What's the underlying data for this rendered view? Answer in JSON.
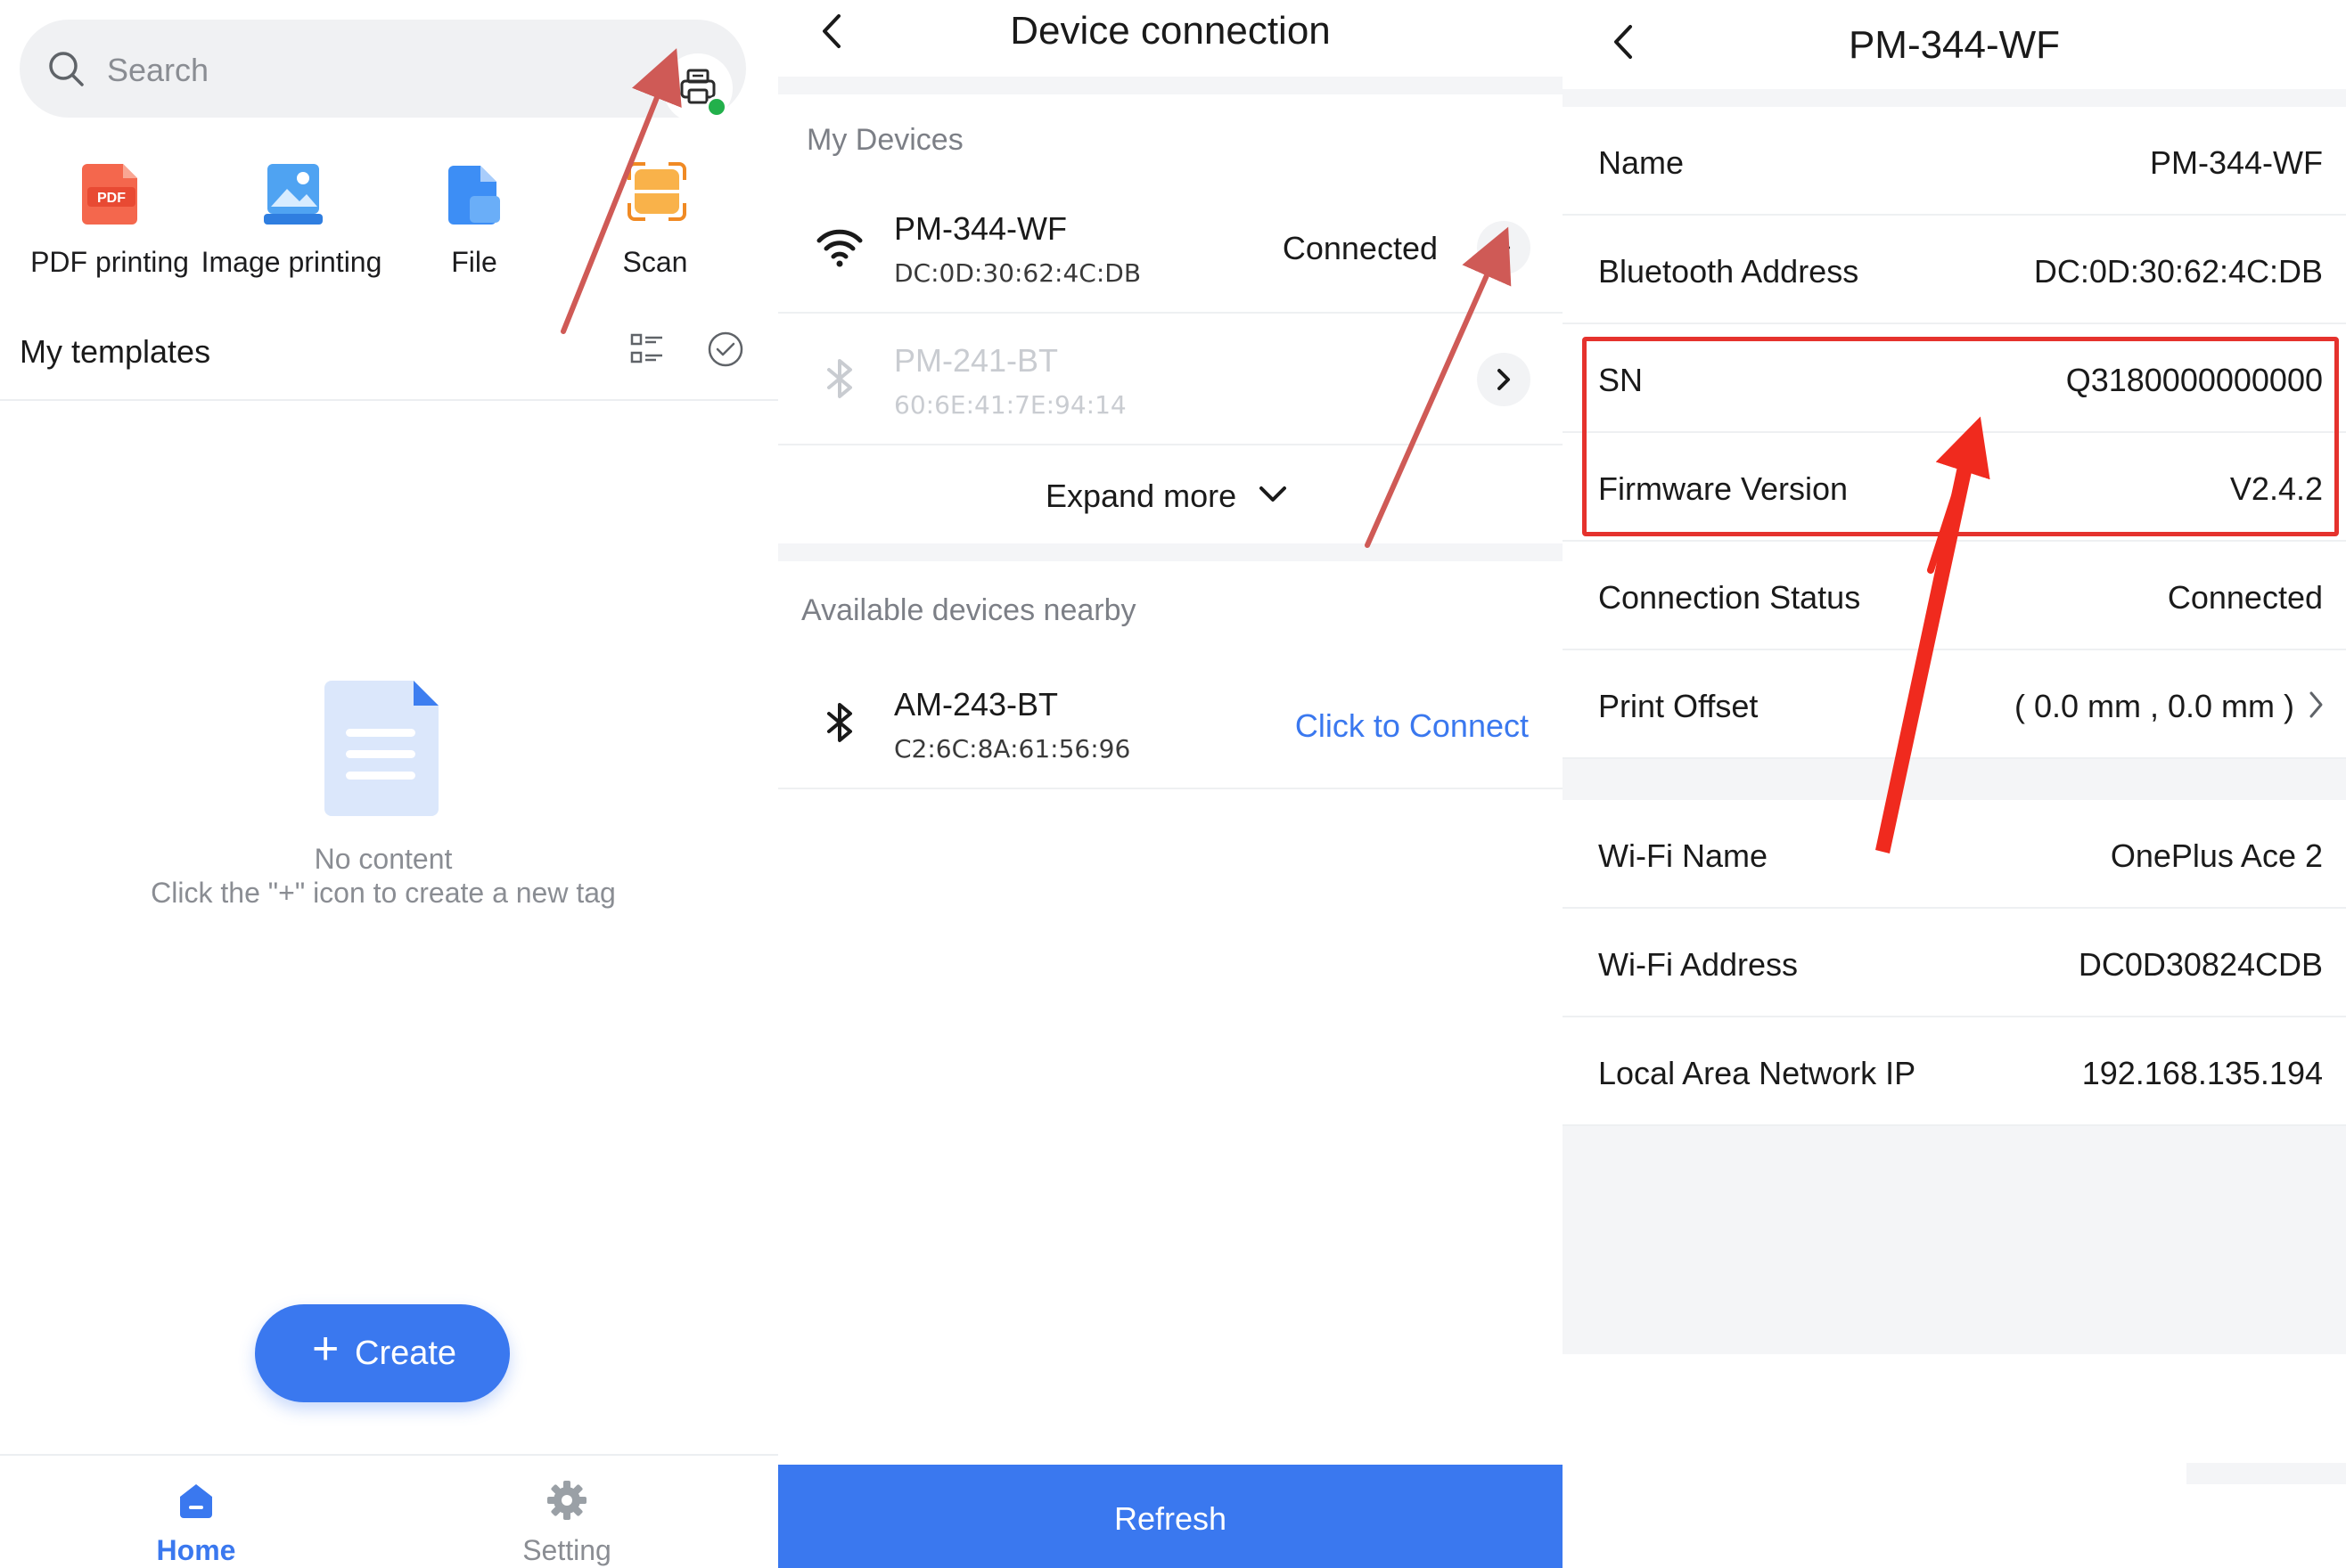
{
  "home": {
    "search_placeholder": "Search",
    "tools": [
      {
        "label": "PDF printing",
        "icon": "pdf-icon"
      },
      {
        "label": "Image printing",
        "icon": "image-icon"
      },
      {
        "label": "File",
        "icon": "file-icon"
      },
      {
        "label": "Scan",
        "icon": "scan-icon"
      }
    ],
    "pdf_badge": "PDF",
    "templates_title": "My templates",
    "empty_title": "No content",
    "empty_hint": "Click the \"+\" icon to create a new tag",
    "create_label": "Create",
    "tabs": [
      {
        "label": "Home",
        "icon": "home-icon",
        "active": true
      },
      {
        "label": "Setting",
        "icon": "gear-icon",
        "active": false
      }
    ],
    "accent_color": "#3a78ef"
  },
  "devices": {
    "title": "Device connection",
    "my_devices_label": "My Devices",
    "my_devices": [
      {
        "name": "PM-344-WF",
        "address": "DC:0D:30:62:4C:DB",
        "status": "Connected",
        "icon": "wifi-icon",
        "enabled": true
      },
      {
        "name": "PM-241-BT",
        "address": "60:6E:41:7E:94:14",
        "status": "",
        "icon": "bluetooth-icon",
        "enabled": false
      }
    ],
    "expand_label": "Expand more",
    "nearby_label": "Available devices nearby",
    "nearby": [
      {
        "name": "AM-243-BT",
        "address": "C2:6C:8A:61:56:96",
        "action": "Click to Connect",
        "icon": "bluetooth-icon"
      }
    ],
    "refresh_label": "Refresh"
  },
  "detail": {
    "title": "PM-344-WF",
    "group1": [
      {
        "label": "Name",
        "value": "PM-344-WF"
      },
      {
        "label": "Bluetooth Address",
        "value": "DC:0D:30:62:4C:DB"
      },
      {
        "label": "SN",
        "value": "Q3180000000000"
      },
      {
        "label": "Firmware Version",
        "value": "V2.4.2"
      },
      {
        "label": "Connection Status",
        "value": "Connected"
      },
      {
        "label": "Print Offset",
        "value": "( 0.0 mm , 0.0 mm )"
      }
    ],
    "group2": [
      {
        "label": "Wi-Fi Name",
        "value": "OnePlus Ace 2"
      },
      {
        "label": "Wi-Fi Address",
        "value": "DC0D30824CDB"
      },
      {
        "label": "Local Area Network IP",
        "value": "192.168.135.194"
      }
    ],
    "highlight_color": "#e5322d"
  }
}
